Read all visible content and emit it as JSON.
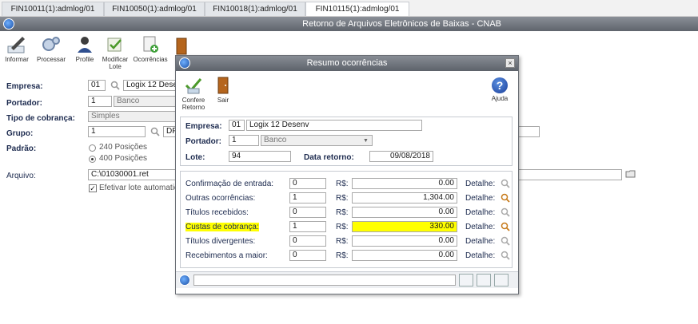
{
  "tabs": [
    {
      "label": "FIN10011(1):admlog/01"
    },
    {
      "label": "FIN10050(1):admlog/01"
    },
    {
      "label": "FIN10018(1):admlog/01"
    },
    {
      "label": "FIN10115(1):admlog/01"
    }
  ],
  "window": {
    "title": "Retorno de Arquivos Eletrônicos de Baixas - CNAB"
  },
  "toolbar": {
    "informar": "Informar",
    "processar": "Processar",
    "profile": "Profile",
    "modificar_lote": "Modificar Lote",
    "ocorrencias": "Ocorrências"
  },
  "form": {
    "empresa_label": "Empresa:",
    "empresa_code": "01",
    "empresa_name": "Logix 12 Desenv",
    "portador_label": "Portador:",
    "portador_code": "1",
    "portador_name": "Banco",
    "tipo_cobranca_label": "Tipo de cobrança:",
    "tipo_cobranca_value": "Simples",
    "grupo_label": "Grupo:",
    "grupo_code": "1",
    "grupo_name": "DF",
    "padrao_label": "Padrão:",
    "padrao_option_1": "240 Posições",
    "padrao_option_2": "400 Posições",
    "padrao_selected": "400 Posições",
    "arquivo_label": "Arquivo:",
    "arquivo_value": "C:\\01030001.ret",
    "efetivar_label": "Efetivar lote automatica"
  },
  "dialog": {
    "title": "Resumo ocorrências",
    "close_label": "×",
    "confere_retorno": "Confere Retorno",
    "sair": "Sair",
    "ajuda": "Ajuda",
    "empresa_label": "Empresa:",
    "empresa_code": "01",
    "empresa_name": "Logix 12 Desenv",
    "portador_label": "Portador:",
    "portador_code": "1",
    "portador_name": "Banco",
    "lote_label": "Lote:",
    "lote_value": "94",
    "data_retorno_label": "Data retorno:",
    "data_retorno_value": "09/08/2018",
    "currency_label": "R$:",
    "detalhe_label": "Detalhe:",
    "rows": [
      {
        "label": "Confirmação de entrada:",
        "count": "0",
        "amount": "0.00",
        "highlighted": false
      },
      {
        "label": "Outras ocorrências:",
        "count": "1",
        "amount": "1,304.00",
        "highlighted": false
      },
      {
        "label": "Títulos recebidos:",
        "count": "0",
        "amount": "0.00",
        "highlighted": false
      },
      {
        "label": "Custas de cobrança:",
        "count": "1",
        "amount": "330.00",
        "highlighted": true
      },
      {
        "label": "Títulos divergentes:",
        "count": "0",
        "amount": "0.00",
        "highlighted": false
      },
      {
        "label": "Recebimentos a maior:",
        "count": "0",
        "amount": "0.00",
        "highlighted": false
      }
    ]
  },
  "colors": {
    "highlight": "#ffff00",
    "label_blue": "#1d2b4f",
    "titlebar": "#6b7078"
  }
}
